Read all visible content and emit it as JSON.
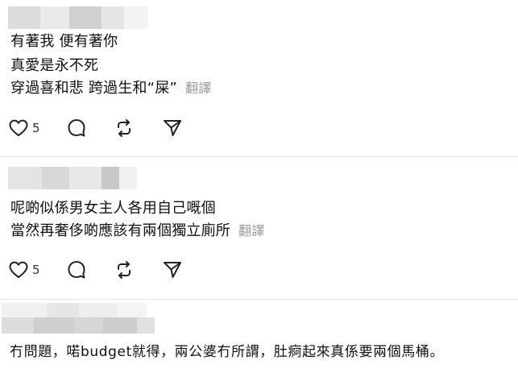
{
  "posts": [
    {
      "lines": [
        "有著我 便有著你",
        "真愛是永不死"
      ],
      "last_line": "穿過喜和悲 跨過生和“屎”",
      "translate": "翻譯",
      "likes": "5"
    },
    {
      "lines": [
        "呢啲似係男女主人各用自己嘅個"
      ],
      "last_line": "當然再奢侈啲應該有兩個獨立廁所",
      "translate": "翻譯",
      "likes": "5"
    },
    {
      "last_line": "冇問題，喏budget就得，兩公婆冇所謂，肚痾起來真係要兩個馬桶。"
    }
  ],
  "colors": {
    "divider": "#e3e3e3",
    "translate_text": "#9a9a9a",
    "icon_stroke": "#222222"
  },
  "icons": [
    "heart-icon",
    "comment-icon",
    "repost-icon",
    "send-icon"
  ]
}
